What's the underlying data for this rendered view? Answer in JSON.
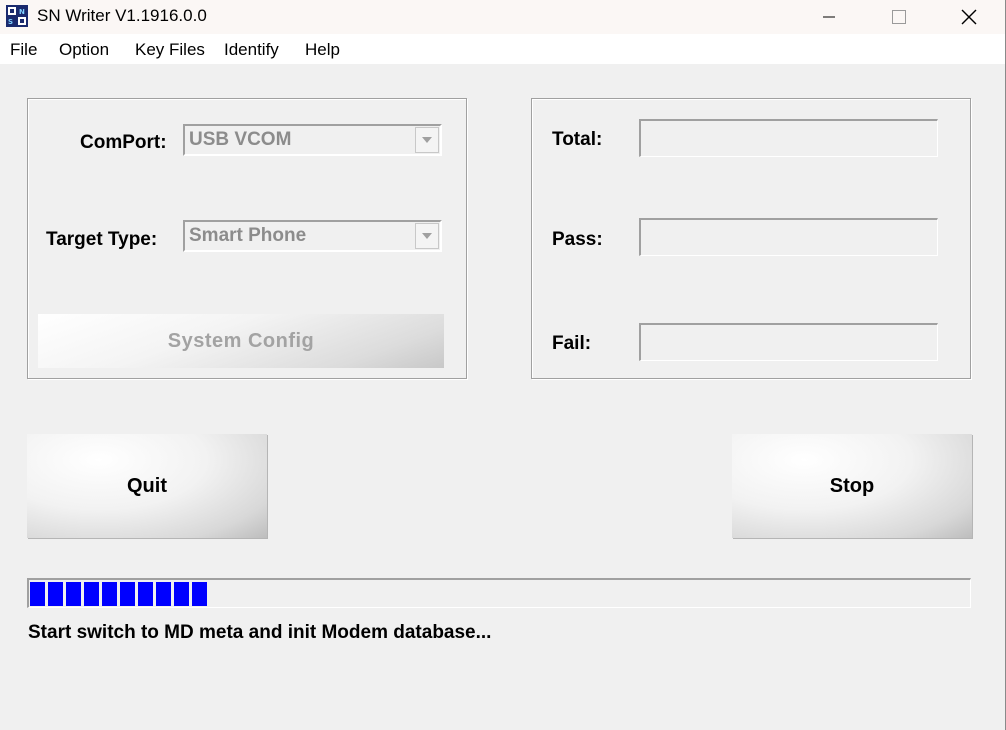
{
  "window": {
    "title": "SN Writer V1.1916.0.0",
    "icon": "sn-writer-app-icon",
    "controls": {
      "minimize": "minimize-icon",
      "maximize": "maximize-icon",
      "close": "close-icon"
    }
  },
  "menu": {
    "items": [
      {
        "label": "File"
      },
      {
        "label": "Option"
      },
      {
        "label": "Key Files"
      },
      {
        "label": "Identify"
      },
      {
        "label": "Help"
      }
    ]
  },
  "config": {
    "comport_label": "ComPort:",
    "comport_value": "USB VCOM",
    "target_type_label": "Target Type:",
    "target_type_value": "Smart Phone",
    "system_config_label": "System Config"
  },
  "stats": {
    "total_label": "Total:",
    "total_value": "",
    "pass_label": "Pass:",
    "pass_value": "",
    "fail_label": "Fail:",
    "fail_value": ""
  },
  "actions": {
    "quit_label": "Quit",
    "stop_label": "Stop"
  },
  "progress": {
    "fraction": 0.19,
    "color": "#0000ff"
  },
  "status": {
    "message": "Start switch to MD meta and init Modem database..."
  }
}
